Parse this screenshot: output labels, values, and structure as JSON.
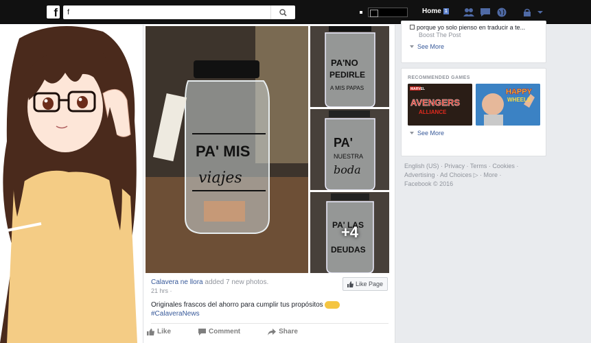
{
  "topbar": {
    "search_value": "f",
    "home_label": "Home",
    "home_badge": "1"
  },
  "post": {
    "page_name": "Calavera ne llora",
    "action_text": "added 7 new photos.",
    "time": "21 hrs",
    "caption": "Originales frascos del ahorro para cumplir tus propósitos",
    "hashtag": "#CalaveraNews",
    "like_page_label": "Like Page",
    "more_photos": "+4",
    "actions": [
      "Like",
      "Comment",
      "Share"
    ],
    "jars": {
      "main_line1": "PA' MIS",
      "main_line2": "viajes",
      "thumb1_line1": "PA'NO",
      "thumb1_line2": "PEDIRLE",
      "thumb1_line3": "A MIS PAPAS",
      "thumb2_line1": "PA'",
      "thumb2_line2": "NUESTRA",
      "thumb2_line3": "boda",
      "thumb3_line1": "PA' LAS",
      "thumb3_line2": "DEUDAS"
    }
  },
  "sidebar": {
    "trend_text": "porque yo solo pienso en traducir a te...",
    "trend_sub": "Boost The Post",
    "see_more_1": "See More",
    "recommended_title": "RECOMMENDED GAMES",
    "game1_title": "AVENGERS",
    "game1_sub": "ALLIANCE",
    "game1_brand": "MARVEL",
    "game2_title": "HAPPY",
    "game2_sub": "WHEELS",
    "see_more_2": "See More"
  },
  "footer": {
    "links": [
      "English (US)",
      "Privacy",
      "Terms",
      "Cookies",
      "Advertising",
      "Ad Choices",
      "More"
    ],
    "copyright": "Facebook © 2016"
  },
  "colors": {
    "topbar": "#111111",
    "link": "#365899",
    "muted": "#90949c",
    "background": "#e9ebee"
  }
}
